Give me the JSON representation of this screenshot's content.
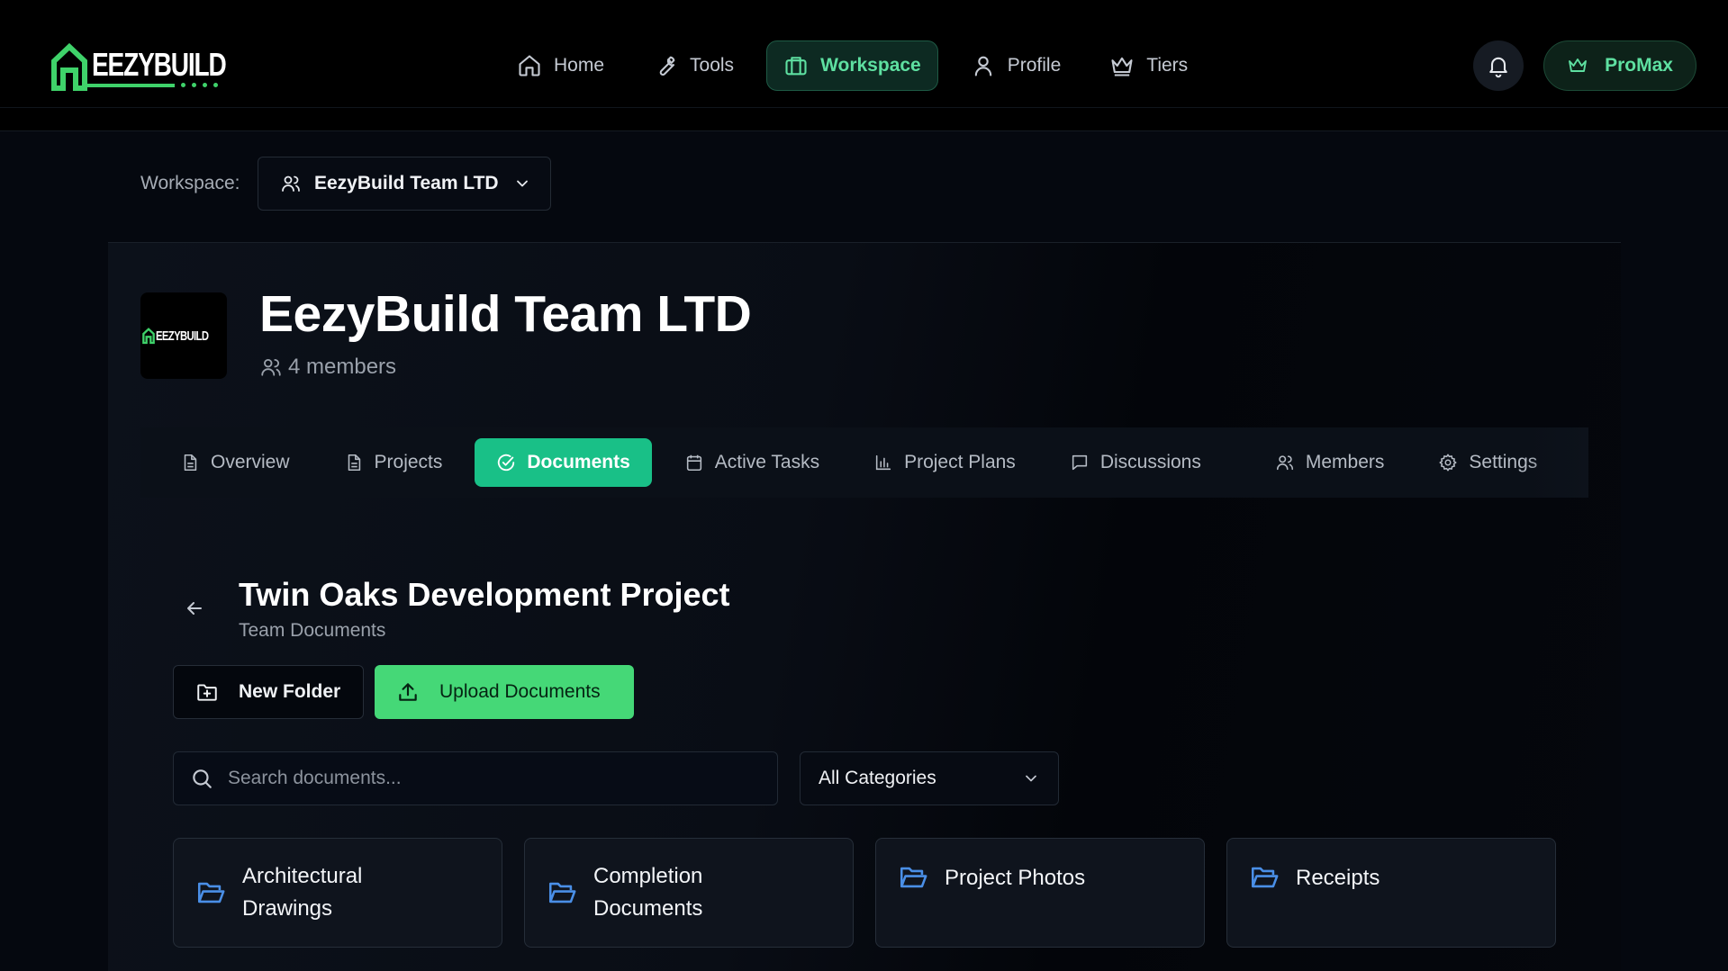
{
  "brand": {
    "name": "EEZYBUILD",
    "accent": "#3fd26a"
  },
  "nav": {
    "items": [
      {
        "label": "Home",
        "icon": "home-icon"
      },
      {
        "label": "Tools",
        "icon": "wrench-icon"
      },
      {
        "label": "Workspace",
        "icon": "briefcase-icon",
        "active": true
      },
      {
        "label": "Profile",
        "icon": "user-icon"
      },
      {
        "label": "Tiers",
        "icon": "crown-icon"
      }
    ],
    "notifications_icon": "bell-icon",
    "plan_badge": "ProMax"
  },
  "workspace": {
    "label": "Workspace:",
    "selected": "EezyBuild Team LTD"
  },
  "team": {
    "name": "EezyBuild Team LTD",
    "members": "4 members",
    "logo_text": "EEZYBUILD"
  },
  "tabs": [
    {
      "label": "Overview",
      "icon": "document-icon"
    },
    {
      "label": "Projects",
      "icon": "document-icon"
    },
    {
      "label": "Documents",
      "icon": "check-circle-icon",
      "active": true
    },
    {
      "label": "Active Tasks",
      "icon": "calendar-icon"
    },
    {
      "label": "Project Plans",
      "icon": "bar-chart-icon"
    },
    {
      "label": "Discussions",
      "icon": "chat-icon"
    },
    {
      "label": "Members",
      "icon": "users-icon"
    },
    {
      "label": "Settings",
      "icon": "gear-icon"
    }
  ],
  "documents": {
    "title": "Twin Oaks Development Project",
    "subtitle": "Team Documents",
    "new_folder_label": "New Folder",
    "upload_label": "Upload Documents",
    "search_placeholder": "Search documents...",
    "category_selected": "All Categories",
    "folders": [
      {
        "label": "Architectural Drawings"
      },
      {
        "label": "Completion Documents"
      },
      {
        "label": "Project Photos"
      },
      {
        "label": "Receipts"
      }
    ]
  },
  "colors": {
    "primary_green": "#45d877",
    "tab_active": "#19c087",
    "folder_blue": "#4a8fe7"
  }
}
